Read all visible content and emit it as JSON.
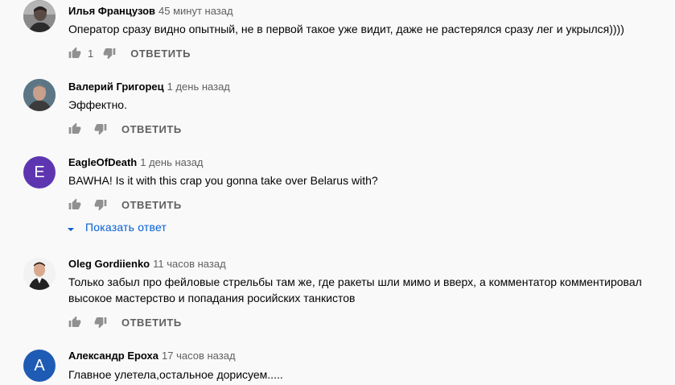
{
  "comments": [
    {
      "author": "Илья Французов",
      "time": "45 минут назад",
      "text": "Оператор сразу видно опытный, не в первой такое уже видит, даже не растерялся сразу лег и укрылся))))",
      "likes": "1",
      "reply_label": "ОТВЕТИТЬ",
      "avatar_type": "photo",
      "avatar_icon": "person-photo-icon"
    },
    {
      "author": "Валерий Григорец",
      "time": "1 день назад",
      "text": "Эффектно.",
      "likes": "",
      "reply_label": "ОТВЕТИТЬ",
      "avatar_type": "photo",
      "avatar_icon": "person-photo-icon"
    },
    {
      "author": "EagleOfDeath",
      "time": "1 день назад",
      "text": "BAWHA! Is it with this crap you gonna take over Belarus with?",
      "likes": "",
      "reply_label": "ОТВЕТИТЬ",
      "avatar_type": "letter",
      "avatar_letter": "E",
      "avatar_color": "#5e35b1",
      "show_replies": "Показать ответ"
    },
    {
      "author": "Oleg Gordiienko",
      "time": "11 часов назад",
      "text": "Только забыл про фейловые стрельбы там же, где ракеты шли мимо и вверх, а комментатор комментировал высокое мастерство и попадания росийских танкистов",
      "likes": "",
      "reply_label": "ОТВЕТИТЬ",
      "avatar_type": "photo",
      "avatar_icon": "person-photo-icon"
    },
    {
      "author": "Александр Ероха",
      "time": "17 часов назад",
      "text": "Главное улетела,остальное дорисуем.....",
      "likes": "",
      "reply_label": "ОТВЕТИТЬ",
      "avatar_type": "letter",
      "avatar_letter": "A",
      "avatar_color": "#1e5bb4"
    }
  ],
  "colors": {
    "background": "#f9f9f9",
    "author": "#030303",
    "meta": "#606060",
    "link_blue": "#065fd4",
    "icon_gray": "#909090"
  },
  "icons": {
    "like": "thumb-up-icon",
    "dislike": "thumb-down-icon",
    "expand": "caret-down-icon"
  }
}
